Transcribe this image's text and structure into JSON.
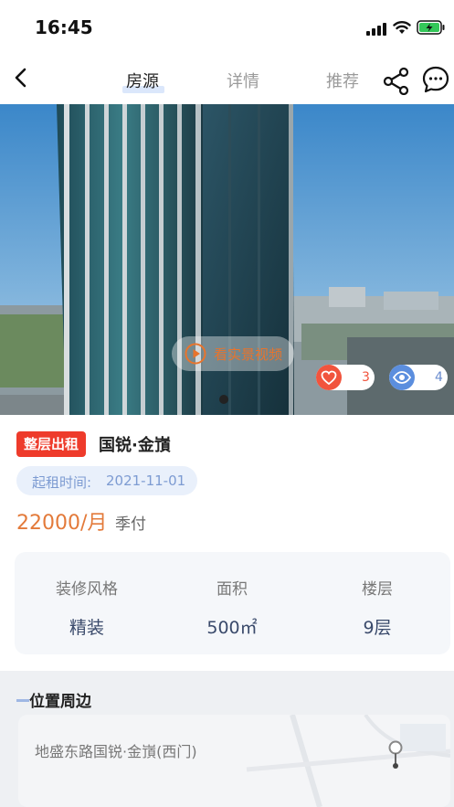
{
  "status_bar": {
    "time": "16:45",
    "icons": [
      "signal-icon",
      "wifi-icon",
      "battery-charging-icon"
    ],
    "battery_color": "#34c759"
  },
  "nav": {
    "back_icon": "back-arrow-icon",
    "tabs": [
      {
        "label": "房源",
        "active": true
      },
      {
        "label": "详情",
        "active": false
      },
      {
        "label": "推荐",
        "active": false
      }
    ],
    "share_icon": "share-icon",
    "chat_icon": "chat-bubble-icon"
  },
  "media": {
    "video_label": "看实景视频",
    "like_count": "3",
    "view_count": "4",
    "icons": [
      "play-icon",
      "heart-icon",
      "eye-icon"
    ]
  },
  "listing": {
    "badge": "整层出租",
    "title": "国锐·金嵿",
    "start_date_label": "起租时间:",
    "start_date_value": "2021-11-01",
    "price": "22000/月",
    "payment": "季付",
    "specs": [
      {
        "label": "装修风格",
        "value": "精装"
      },
      {
        "label": "面积",
        "value": "500㎡"
      },
      {
        "label": "楼层",
        "value": "9层"
      }
    ]
  },
  "location": {
    "section_title": "位置周边",
    "address": "地盛东路国锐·金嵿(西门)",
    "icon": "map-pin-icon"
  },
  "colors": {
    "accent_orange": "#e37a3a",
    "badge_red": "#ee3b2b",
    "accent_blue": "#7d9bd2"
  }
}
